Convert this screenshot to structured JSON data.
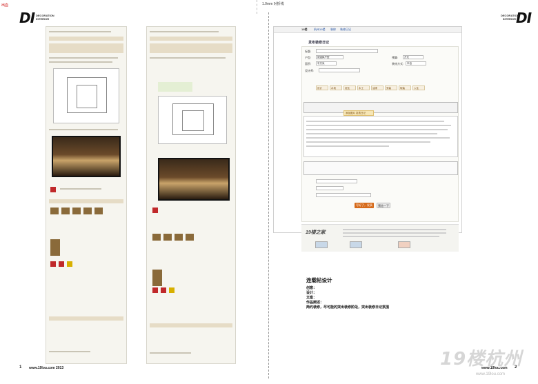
{
  "corner_mark": "出血",
  "top_mark": "1.0mm  对折线",
  "brand": {
    "logo": "DI",
    "logo_sub": "DECORATION INTERIOR"
  },
  "left_page": {
    "page_number": "1",
    "url": "www.19lou.com 2013"
  },
  "right_page": {
    "page_number": "2",
    "url": "www.19lou.com"
  },
  "screenshot": {
    "site_name": "19楼",
    "nav": [
      "杭州19楼",
      "装修",
      "装修日记"
    ],
    "form_title": "发布装修日记",
    "fields": [
      {
        "label": "标题:",
        "value": ""
      },
      {
        "label": "户型:",
        "value": "请选择户型"
      },
      {
        "label": "面积:",
        "value": "平方米"
      },
      {
        "label": "预算:",
        "value": "万元"
      },
      {
        "label": "装修方式:",
        "value": "半包"
      },
      {
        "label": "设计师:",
        "value": ""
      }
    ],
    "tabs": [
      "设计",
      "水电",
      "泥瓦",
      "木工",
      "油漆",
      "安装",
      "软装",
      "入住"
    ],
    "highlight_note": "添加图片 发表日记",
    "editor_placeholder": "",
    "submit_label": "写好了，发表",
    "preview_label": "预览一下",
    "footer_brand": "19楼之家"
  },
  "caption": {
    "title": "连载帖设计",
    "lines": [
      "创意：",
      "设计：",
      "文案：",
      "作品阐述：",
      "简约装修，尽可能的突出装修阶段，突出装修日记氛围"
    ]
  },
  "watermark": {
    "text": "19楼杭州",
    "sub": "www.19lou.com"
  },
  "colors": {
    "accent": "#d66a1a",
    "tab_bg": "#f7efe0",
    "badge": "#c0282a"
  }
}
